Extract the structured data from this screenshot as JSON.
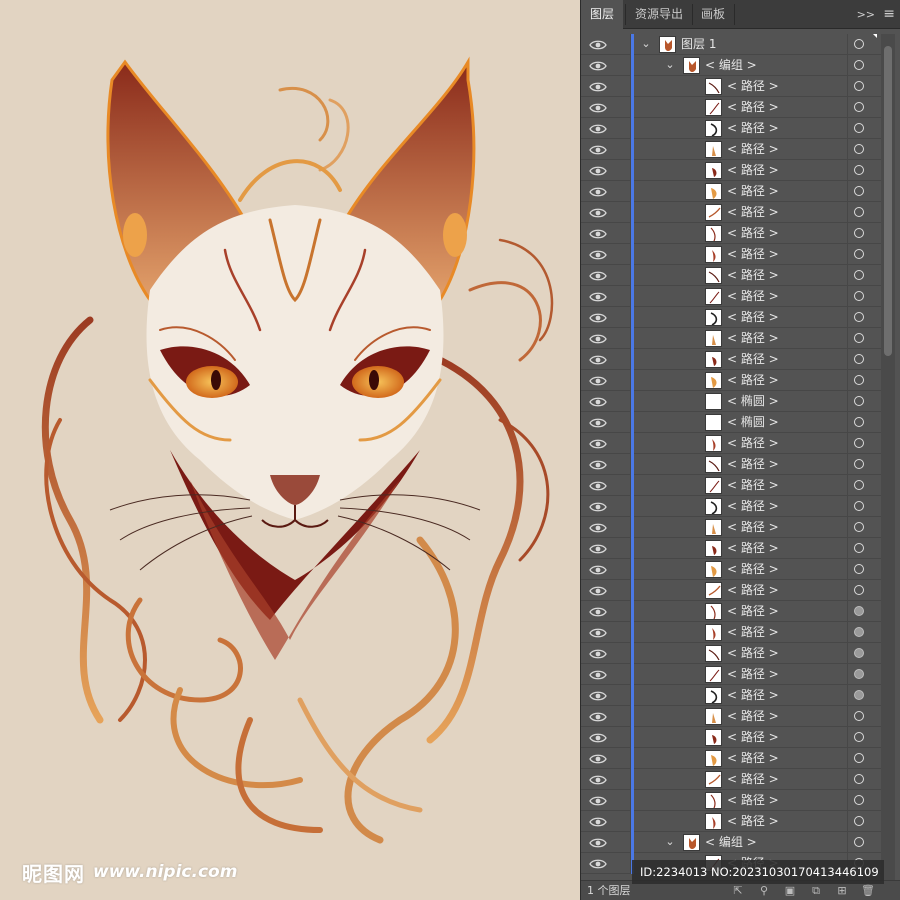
{
  "colors": {
    "canvas_bg": "#e2d4c2",
    "panel_bg": "#535353",
    "accent_blue": "#4a78e6",
    "art_dark": "#7a1a14",
    "art_mid": "#b8572b",
    "art_light": "#e89a3a"
  },
  "watermark": {
    "logo": "昵图网",
    "url": "www.nipic.com"
  },
  "panel": {
    "tabs": [
      {
        "label": "图层",
        "active": true
      },
      {
        "label": "资源导出",
        "active": false
      },
      {
        "label": "画板",
        "active": false
      }
    ],
    "collapse_icon": "double-chevron-right-icon",
    "menu_icon": "hamburger-menu-icon",
    "footer": {
      "layer_count": "1 个图层",
      "icons": [
        "export-icon",
        "search-icon",
        "clip-mask-icon",
        "sublayer-icon",
        "new-layer-icon",
        "trash-icon"
      ]
    }
  },
  "rows": [
    {
      "label": "图层 1",
      "indent": 0,
      "type": "layer",
      "expanded": true,
      "target": "empty",
      "selected_corner": true
    },
    {
      "label": "< 编组 >",
      "indent": 1,
      "type": "group",
      "expanded": true,
      "target": "empty"
    },
    {
      "label": "< 路径 >",
      "indent": 2,
      "type": "path",
      "target": "empty"
    },
    {
      "label": "< 路径 >",
      "indent": 2,
      "type": "path",
      "target": "empty"
    },
    {
      "label": "< 路径 >",
      "indent": 2,
      "type": "path",
      "target": "empty"
    },
    {
      "label": "< 路径 >",
      "indent": 2,
      "type": "path",
      "target": "empty"
    },
    {
      "label": "< 路径 >",
      "indent": 2,
      "type": "path",
      "target": "empty"
    },
    {
      "label": "< 路径 >",
      "indent": 2,
      "type": "path",
      "target": "empty"
    },
    {
      "label": "< 路径 >",
      "indent": 2,
      "type": "path",
      "target": "empty"
    },
    {
      "label": "< 路径 >",
      "indent": 2,
      "type": "path",
      "target": "empty"
    },
    {
      "label": "< 路径 >",
      "indent": 2,
      "type": "path",
      "target": "empty"
    },
    {
      "label": "< 路径 >",
      "indent": 2,
      "type": "path",
      "target": "empty"
    },
    {
      "label": "< 路径 >",
      "indent": 2,
      "type": "path",
      "target": "empty"
    },
    {
      "label": "< 路径 >",
      "indent": 2,
      "type": "path",
      "target": "empty"
    },
    {
      "label": "< 路径 >",
      "indent": 2,
      "type": "path",
      "target": "empty"
    },
    {
      "label": "< 路径 >",
      "indent": 2,
      "type": "path",
      "target": "empty"
    },
    {
      "label": "< 路径 >",
      "indent": 2,
      "type": "path",
      "target": "empty"
    },
    {
      "label": "< 椭圆 >",
      "indent": 2,
      "type": "ellipse",
      "target": "empty"
    },
    {
      "label": "< 椭圆 >",
      "indent": 2,
      "type": "ellipse",
      "target": "empty"
    },
    {
      "label": "< 路径 >",
      "indent": 2,
      "type": "path",
      "target": "empty"
    },
    {
      "label": "< 路径 >",
      "indent": 2,
      "type": "path",
      "target": "empty"
    },
    {
      "label": "< 路径 >",
      "indent": 2,
      "type": "path",
      "target": "empty"
    },
    {
      "label": "< 路径 >",
      "indent": 2,
      "type": "path",
      "target": "empty"
    },
    {
      "label": "< 路径 >",
      "indent": 2,
      "type": "path",
      "target": "empty"
    },
    {
      "label": "< 路径 >",
      "indent": 2,
      "type": "path",
      "target": "empty"
    },
    {
      "label": "< 路径 >",
      "indent": 2,
      "type": "path",
      "target": "empty"
    },
    {
      "label": "< 路径 >",
      "indent": 2,
      "type": "path",
      "target": "empty"
    },
    {
      "label": "< 路径 >",
      "indent": 2,
      "type": "path",
      "target": "filled"
    },
    {
      "label": "< 路径 >",
      "indent": 2,
      "type": "path",
      "target": "filled"
    },
    {
      "label": "< 路径 >",
      "indent": 2,
      "type": "path",
      "target": "filled"
    },
    {
      "label": "< 路径 >",
      "indent": 2,
      "type": "path",
      "target": "filled"
    },
    {
      "label": "< 路径 >",
      "indent": 2,
      "type": "path",
      "target": "filled"
    },
    {
      "label": "< 路径 >",
      "indent": 2,
      "type": "path",
      "target": "empty"
    },
    {
      "label": "< 路径 >",
      "indent": 2,
      "type": "path",
      "target": "empty"
    },
    {
      "label": "< 路径 >",
      "indent": 2,
      "type": "path",
      "target": "empty"
    },
    {
      "label": "< 路径 >",
      "indent": 2,
      "type": "path",
      "target": "empty"
    },
    {
      "label": "< 路径 >",
      "indent": 2,
      "type": "path",
      "target": "empty"
    },
    {
      "label": "< 路径 >",
      "indent": 2,
      "type": "path",
      "target": "empty"
    },
    {
      "label": "< 编组 >",
      "indent": 1,
      "type": "group",
      "expanded": true,
      "target": "empty"
    },
    {
      "label": "< 路径 >",
      "indent": 2,
      "type": "path",
      "target": "empty"
    }
  ],
  "id_badge": "ID:2234013 NO:20231030170413446109"
}
